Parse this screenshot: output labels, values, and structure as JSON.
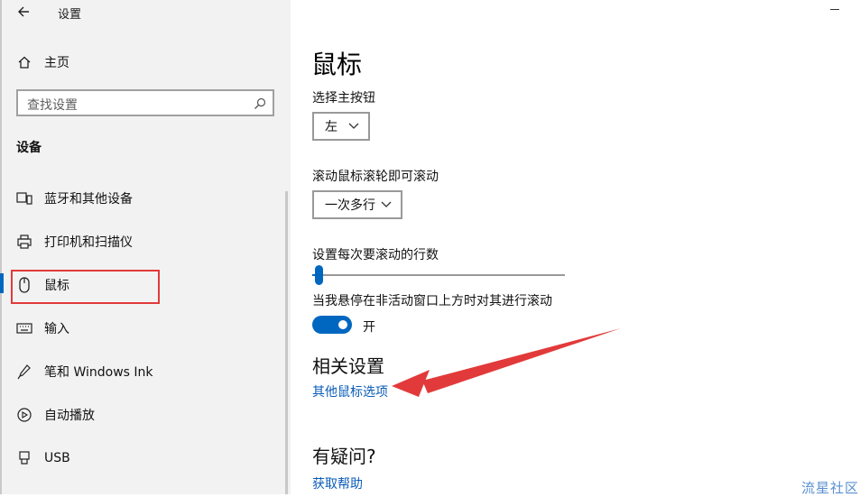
{
  "window": {
    "title": "设置"
  },
  "sidebar": {
    "home_label": "主页",
    "search_placeholder": "查找设置",
    "group_header": "设备",
    "items": [
      {
        "label": "蓝牙和其他设备",
        "icon": "bluetooth-devices-icon"
      },
      {
        "label": "打印机和扫描仪",
        "icon": "printer-icon"
      },
      {
        "label": "鼠标",
        "icon": "mouse-icon",
        "selected": true
      },
      {
        "label": "输入",
        "icon": "keyboard-icon"
      },
      {
        "label": "笔和 Windows Ink",
        "icon": "pen-icon"
      },
      {
        "label": "自动播放",
        "icon": "autoplay-icon"
      },
      {
        "label": "USB",
        "icon": "usb-icon"
      }
    ]
  },
  "main": {
    "title": "鼠标",
    "primary_button": {
      "label": "选择主按钮",
      "value": "左"
    },
    "scroll_mode": {
      "label": "滚动鼠标滚轮即可滚动",
      "value": "一次多行"
    },
    "lines_to_scroll": {
      "label": "设置每次要滚动的行数",
      "level": 0.02
    },
    "inactive_scroll": {
      "label": "当我悬停在非活动窗口上方时对其进行滚动",
      "state": "开",
      "on": true
    },
    "related": {
      "title": "相关设置",
      "link": "其他鼠标选项"
    },
    "help": {
      "title": "有疑问?",
      "link": "获取帮助"
    }
  },
  "watermark": "流星社区",
  "colors": {
    "accent": "#0067c0",
    "annotation": "#e23a3a",
    "link": "#0a5cb8"
  }
}
